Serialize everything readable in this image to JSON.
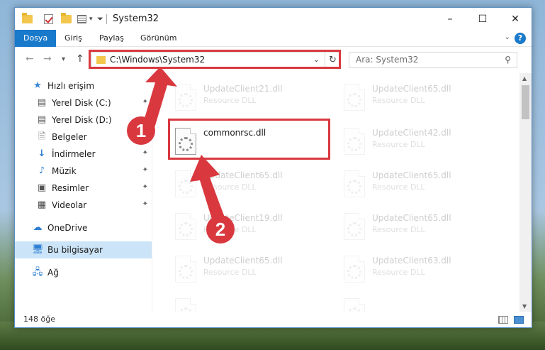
{
  "window": {
    "title": "System32"
  },
  "ribbon": {
    "tabs": [
      {
        "label": "Dosya"
      },
      {
        "label": "Giriş"
      },
      {
        "label": "Paylaş"
      },
      {
        "label": "Görünüm"
      }
    ],
    "help": "?"
  },
  "nav": {
    "back": "←",
    "forward": "→",
    "recent": "▾",
    "up": "↑",
    "address_path": "C:\\Windows\\System32",
    "search_placeholder": "Ara: System32"
  },
  "sidebar": {
    "items": [
      {
        "label": "Hızlı erişim",
        "icon": "star-icon"
      },
      {
        "label": "Yerel Disk (C:)",
        "icon": "drive-icon"
      },
      {
        "label": "Yerel Disk (D:)",
        "icon": "drive-icon"
      },
      {
        "label": "Belgeler",
        "icon": "documents-icon"
      },
      {
        "label": "İndirmeler",
        "icon": "download-icon"
      },
      {
        "label": "Müzik",
        "icon": "music-icon"
      },
      {
        "label": "Resimler",
        "icon": "pictures-icon"
      },
      {
        "label": "Videolar",
        "icon": "video-icon"
      },
      {
        "label": "OneDrive",
        "icon": "cloud-icon"
      },
      {
        "label": "Bu bilgisayar",
        "icon": "computer-icon"
      },
      {
        "label": "Ağ",
        "icon": "network-icon"
      }
    ]
  },
  "files": [
    {
      "name": "UpdateClient21.dll",
      "type": "Resource DLL"
    },
    {
      "name": "UpdateClient65.dll",
      "type": "Resource DLL"
    },
    {
      "name": "commonrsc.dll",
      "type": ""
    },
    {
      "name": "UpdateClient42.dll",
      "type": "Resource DLL"
    },
    {
      "name": "UpdateClient65.dll",
      "type": "Resource DLL"
    },
    {
      "name": "UpdateClient65.dll",
      "type": "Resource DLL"
    },
    {
      "name": "UpdateClient19.dll",
      "type": "Resource DLL"
    },
    {
      "name": "UpdateClient65.dll",
      "type": "Resource DLL"
    },
    {
      "name": "UpdateClient65.dll",
      "type": "Resource DLL"
    },
    {
      "name": "UpdateClient63.dll",
      "type": "Resource DLL"
    },
    {
      "name": "",
      "type": ""
    },
    {
      "name": "",
      "type": ""
    }
  ],
  "status": {
    "count": "148 öğe"
  },
  "annotations": {
    "step1": "1",
    "step2": "2",
    "color": "#d9383f"
  }
}
